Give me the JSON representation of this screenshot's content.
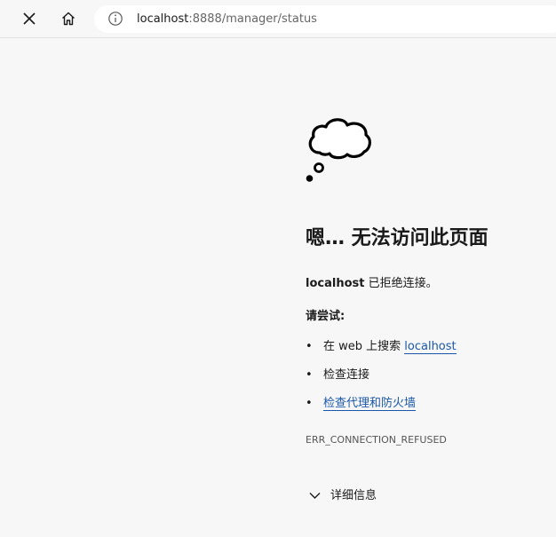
{
  "browser": {
    "url_host": "localhost",
    "url_rest": ":8888/manager/status"
  },
  "error_page": {
    "heading": "嗯… 无法访问此页面",
    "message_host": "localhost",
    "message_rest": " 已拒绝连接。",
    "try_label": "请尝试:",
    "suggestions": [
      {
        "prefix": "在 web 上搜索 ",
        "link": "localhost"
      },
      {
        "text": "检查连接"
      },
      {
        "link": "检查代理和防火墙"
      }
    ],
    "error_code": "ERR_CONNECTION_REFUSED",
    "details_label": "详细信息"
  },
  "icons": {
    "close": "close-icon",
    "home": "home-icon",
    "info": "info-icon",
    "cloud": "thinking-cloud-icon",
    "chevron": "chevron-down-icon"
  },
  "colors": {
    "link": "#1a57a8",
    "background": "#f7f7f7"
  }
}
